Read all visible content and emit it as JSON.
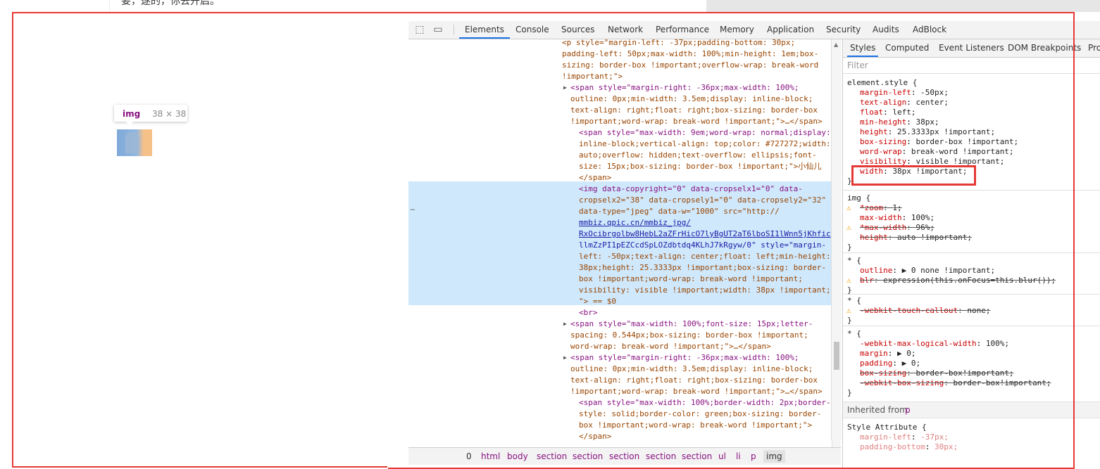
{
  "page": {
    "top_text": "要，遂的，你去开启。"
  },
  "tooltip": {
    "tag": "img",
    "dims": "38 × 38"
  },
  "devtools": {
    "tabs": [
      "Elements",
      "Console",
      "Sources",
      "Network",
      "Performance",
      "Memory",
      "Application",
      "Security",
      "Audits",
      "AdBlock"
    ],
    "active_tab": "Elements",
    "icons": [
      "inspect-cursor-icon",
      "device-toggle-icon"
    ],
    "dom_lines": [
      {
        "kind": "plain",
        "text": "<p style=\"margin-left: -37px;padding-bottom: 30px;"
      },
      {
        "kind": "plain",
        "text": "padding-left: 50px;max-width: 100%;min-height: 1em;box-"
      },
      {
        "kind": "plain",
        "text": "sizing: border-box !important;overflow-wrap: break-word"
      },
      {
        "kind": "plain",
        "text": "!important;\">"
      },
      {
        "kind": "tag",
        "text": "<span style=\"margin-right: -36px;max-width: 100%;"
      },
      {
        "kind": "plain",
        "text": "outline: 0px;min-width: 3.5em;display: inline-block;"
      },
      {
        "kind": "plain",
        "text": "text-align: right;float: right;box-sizing: border-box"
      },
      {
        "kind": "plain",
        "text": "!important;word-wrap: break-word !important;\">…</span>"
      },
      {
        "kind": "tag",
        "text": "<span style=\"max-width: 9em;word-wrap: normal;display:"
      },
      {
        "kind": "plain",
        "text": "inline-block;vertical-align: top;color: #727272;width:"
      },
      {
        "kind": "plain",
        "text": "auto;overflow: hidden;text-overflow: ellipsis;font-"
      },
      {
        "kind": "plain",
        "text": "size: 15px;box-sizing: border-box !important;\">小仙儿"
      },
      {
        "kind": "plain",
        "text": "</span>"
      },
      {
        "kind": "tag",
        "text": "<img data-copyright=\"0\" data-cropselx1=\"0\" data-"
      },
      {
        "kind": "plain",
        "text": "cropselx2=\"38\" data-cropsely1=\"0\" data-cropsely2=\"32\""
      },
      {
        "kind": "plain",
        "text": "data-type=\"jpeg\" data-w=\"1000\" src=\"http://"
      },
      {
        "kind": "link",
        "text": "mmbiz.qpic.cn/mmbiz_jpg/"
      },
      {
        "kind": "link",
        "text": "RxOcibrgolbw8HebL2aZFrHicO7lyBgUT2aT6lboSI1lWnn5jKhfic"
      },
      {
        "kind": "mixed",
        "text": "llmZzPI1pEZCcdSpLOZdbtdq4KLhJ7kRgyw/0\" style=\"margin-"
      },
      {
        "kind": "plain",
        "text": "left: -50px;text-align: center;float: left;min-height:"
      },
      {
        "kind": "plain",
        "text": "38px;height: 25.3333px !important;box-sizing: border-"
      },
      {
        "kind": "plain",
        "text": "box !important;word-wrap: break-word !important;"
      },
      {
        "kind": "plain",
        "text": "visibility: visible !important;width: 38px !important;"
      },
      {
        "kind": "plain",
        "text": "\"> == $0"
      },
      {
        "kind": "tag",
        "text": "<br>"
      },
      {
        "kind": "tag",
        "text": "<span style=\"max-width: 100%;font-size: 15px;letter-"
      },
      {
        "kind": "plain",
        "text": "spacing: 0.544px;box-sizing: border-box !important;"
      },
      {
        "kind": "plain",
        "text": "word-wrap: break-word !important;\">…</span>"
      },
      {
        "kind": "tag",
        "text": "<span style=\"margin-right: -36px;max-width: 100%;"
      },
      {
        "kind": "plain",
        "text": "outline: 0px;min-width: 3.5em;display: inline-block;"
      },
      {
        "kind": "plain",
        "text": "text-align: right;float: right;box-sizing: border-box"
      },
      {
        "kind": "plain",
        "text": "!important;word-wrap: break-word !important;\">…</span>"
      },
      {
        "kind": "tag",
        "text": "<span style=\"max-width: 100%;border-width: 2px;border-"
      },
      {
        "kind": "plain",
        "text": "style: solid;border-color: green;box-sizing: border-"
      },
      {
        "kind": "plain",
        "text": "box !important;word-wrap: break-word !important;\">"
      },
      {
        "kind": "plain",
        "text": "</span>"
      }
    ],
    "breadcrumb": [
      "0",
      "html",
      "body",
      "section",
      "section",
      "section",
      "section",
      "section",
      "ul",
      "li",
      "p",
      "img"
    ],
    "styles_tabs": [
      "Styles",
      "Computed",
      "Event Listeners",
      "DOM Breakpoints",
      "Pro"
    ],
    "filter_placeholder": "Filter",
    "rules": {
      "element_style": {
        "selector": "element.style {",
        "props": [
          {
            "name": "margin-left",
            "value": "-50px;"
          },
          {
            "name": "text-align",
            "value": "center;"
          },
          {
            "name": "float",
            "value": "left;"
          },
          {
            "name": "min-height",
            "value": "38px;"
          },
          {
            "name": "height",
            "value": "25.3333px !important;"
          },
          {
            "name": "box-sizing",
            "value": "border-box !important;"
          },
          {
            "name": "word-wrap",
            "value": "break-word !important;"
          },
          {
            "name": "visibility",
            "value": "visible !important;"
          },
          {
            "name": "width",
            "value": "38px !important;"
          }
        ]
      },
      "img": {
        "selector": "img {",
        "props": [
          {
            "name": "*zoom",
            "value": "1;",
            "struck": true,
            "warn": true
          },
          {
            "name": "max-width",
            "value": "100%;"
          },
          {
            "name": "*max-width",
            "value": "96%;",
            "struck": true,
            "warn": true
          },
          {
            "name": "height",
            "value": "auto !important;",
            "struck": true
          }
        ]
      },
      "star1": {
        "selector": "* {",
        "props": [
          {
            "name": "outline",
            "value": "▶ 0 none !important;"
          },
          {
            "name": "blr",
            "value": "expression(this.onFocus=this.blur());",
            "struck": true,
            "warn": true
          }
        ]
      },
      "star2": {
        "selector": "* {",
        "props": [
          {
            "name": "-webkit-touch-callout",
            "value": "none;",
            "struck": true,
            "warn": true
          }
        ]
      },
      "star3": {
        "selector": "* {",
        "props": [
          {
            "name": "-webkit-max-logical-width",
            "value": "100%;"
          },
          {
            "name": "margin",
            "value": "▶ 0;"
          },
          {
            "name": "padding",
            "value": "▶ 0;"
          },
          {
            "name": "box-sizing",
            "value": "border-box!important;",
            "struck": true
          },
          {
            "name": "-webkit-box-sizing",
            "value": "border-box!important;",
            "struck": true
          }
        ]
      },
      "inherited_label": "Inherited from",
      "inherited_from": "p",
      "style_attr": {
        "selector": "Style Attribute {",
        "props": [
          {
            "name": "margin-left",
            "value": "-37px;"
          },
          {
            "name": "padding-bottom",
            "value": "30px;"
          }
        ]
      },
      "brace_close": "}"
    }
  },
  "colors": {
    "red_annotation": "#e53935",
    "selection_bg": "#cfe8fc",
    "tag_color": "#881280",
    "accent_tab": "#1a73e8"
  }
}
